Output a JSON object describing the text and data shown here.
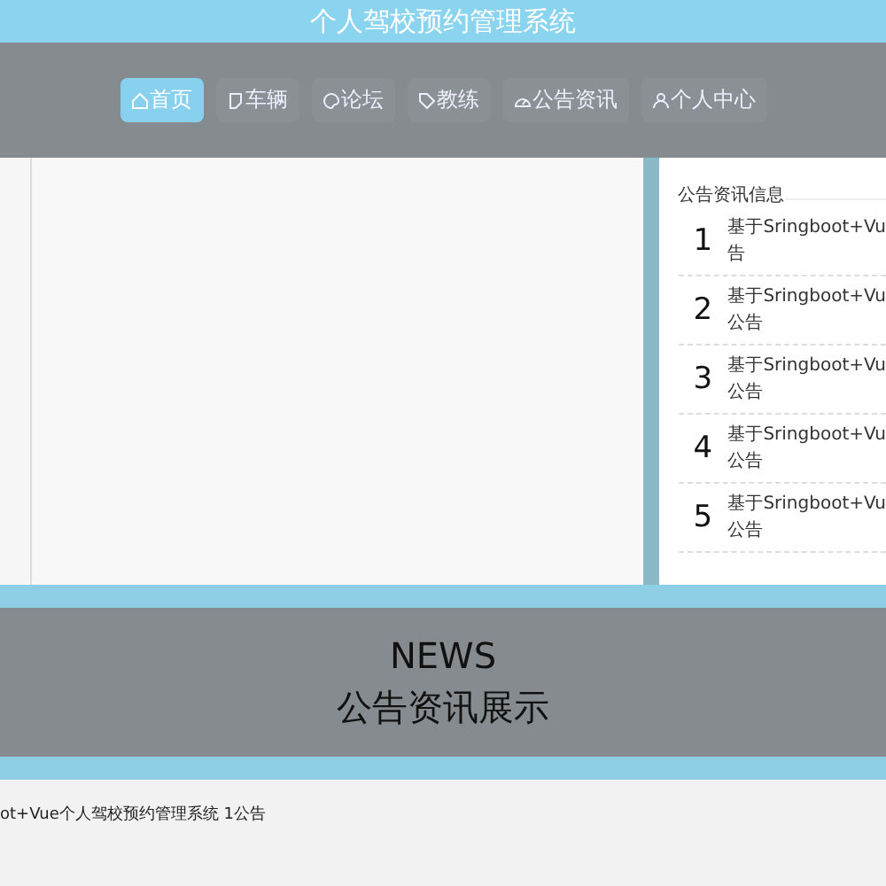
{
  "header": {
    "title": "个人驾校预约管理系统"
  },
  "nav": [
    {
      "label": "首页",
      "selected": true
    },
    {
      "label": "车辆",
      "selected": false
    },
    {
      "label": "论坛",
      "selected": false
    },
    {
      "label": "教练",
      "selected": false
    },
    {
      "label": "公告资讯",
      "selected": false
    },
    {
      "label": "个人中心",
      "selected": false
    }
  ],
  "notice_panel": {
    "title": "公告资讯信息",
    "items": [
      {
        "number": "1",
        "line_1": "基于Sringboot+Vu",
        "line_2": "告"
      },
      {
        "number": "2",
        "line_1": "基于Sringboot+Vu",
        "line_2": "公告"
      },
      {
        "number": "3",
        "line_1": "基于Sringboot+Vu",
        "line_2": "公告"
      },
      {
        "number": "4",
        "line_1": "基于Sringboot+Vu",
        "line_2": "公告"
      },
      {
        "number": "5",
        "line_1": "基于Sringboot+Vu",
        "line_2": "公告"
      }
    ]
  },
  "news_banner": {
    "heading": "NEWS",
    "subheading": "公告资讯展示"
  },
  "news_list": [
    "ot+Vue个人驾校预约管理系统 1公告"
  ]
}
